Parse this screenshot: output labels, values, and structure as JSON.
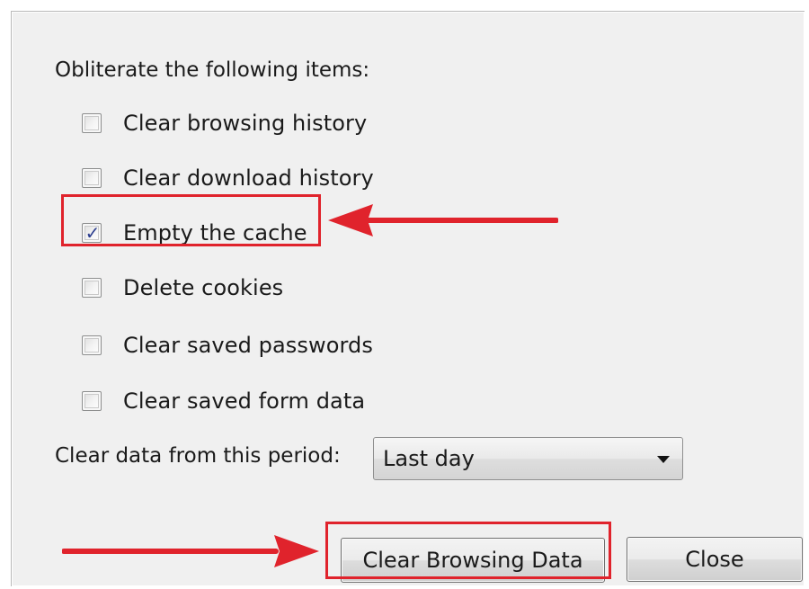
{
  "dialog": {
    "heading": "Obliterate the following items:",
    "options": [
      {
        "label": "Clear browsing history",
        "checked": false
      },
      {
        "label": "Clear download history",
        "checked": false
      },
      {
        "label": "Empty the cache",
        "checked": true
      },
      {
        "label": "Delete cookies",
        "checked": false
      },
      {
        "label": "Clear saved passwords",
        "checked": false
      },
      {
        "label": "Clear saved form data",
        "checked": false
      }
    ],
    "check_mark": "✓",
    "period": {
      "label": "Clear data from this period:",
      "selected": "Last day"
    },
    "buttons": {
      "clear_label": "Clear Browsing Data",
      "close_label": "Close"
    }
  },
  "annotation": {
    "color": "#e0232c",
    "icons": [
      "left-arrow-icon",
      "right-arrow-icon"
    ]
  }
}
